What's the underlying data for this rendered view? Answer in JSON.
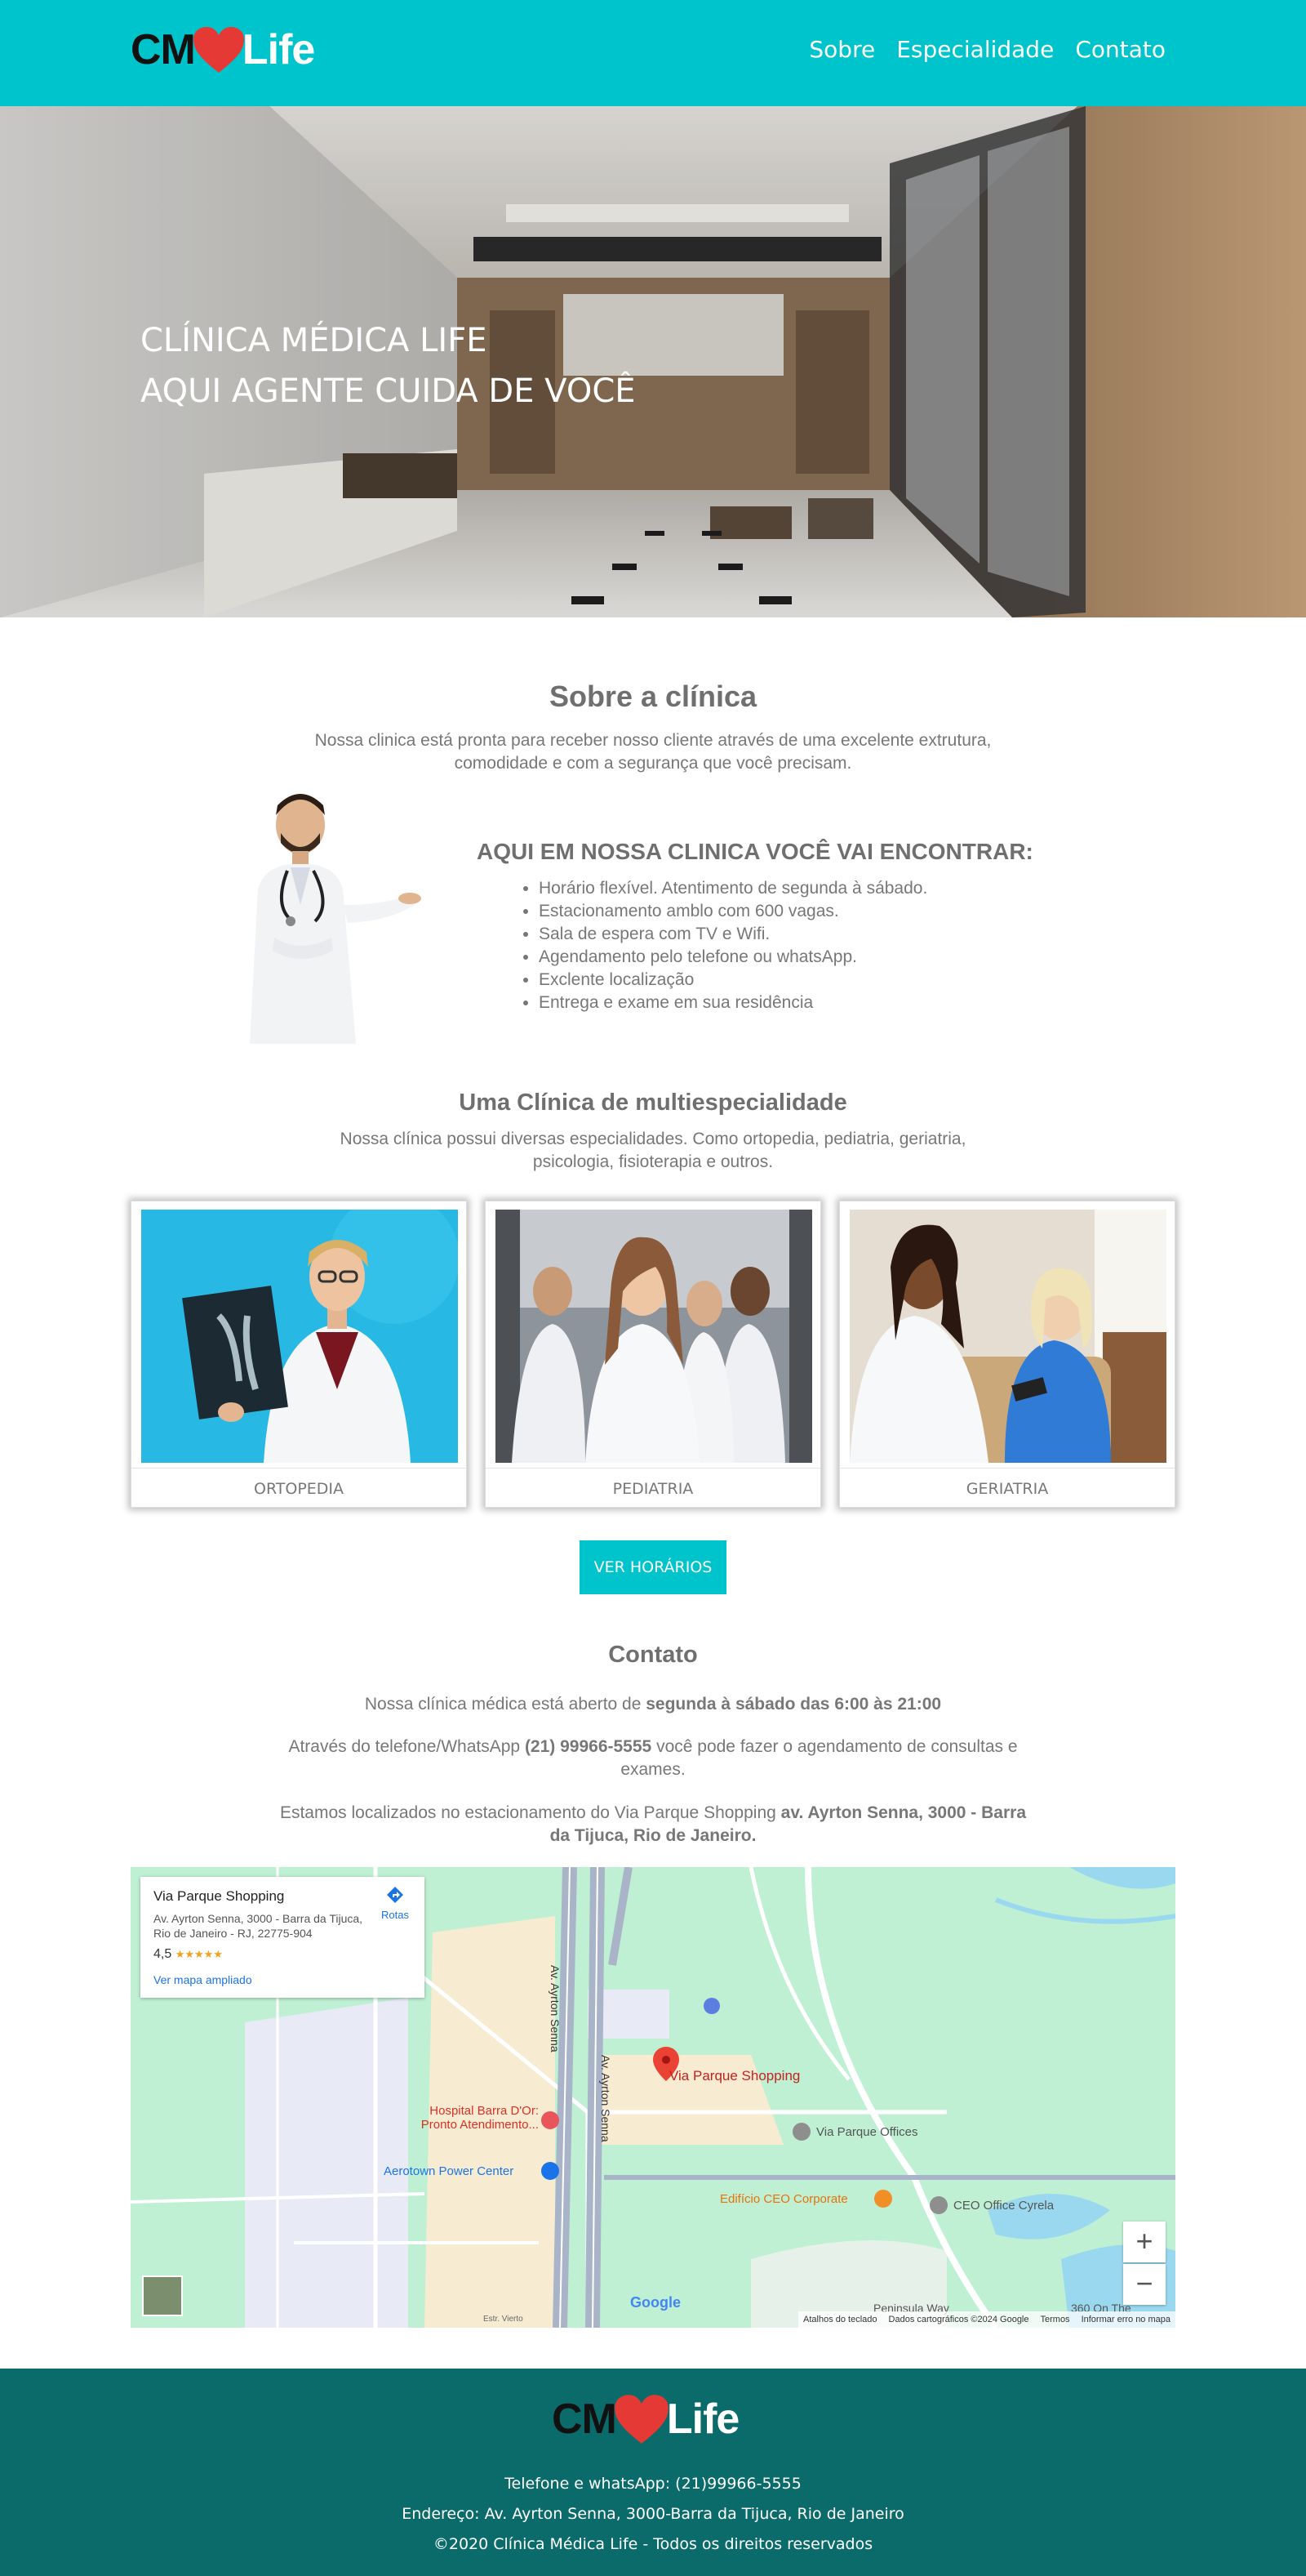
{
  "header": {
    "logo_cm": "CM",
    "logo_life": "Life",
    "nav": [
      "Sobre",
      "Especialidade",
      "Contato"
    ]
  },
  "hero": {
    "line1": "CLÍNICA MÉDICA LIFE",
    "line2": "AQUI AGENTE CUIDA DE VOCÊ"
  },
  "about": {
    "title": "Sobre a clínica",
    "text": "Nossa clinica está pronta para receber nosso cliente através de uma excelente extrutura, comodidade e com a segurança que você precisam.",
    "find_title": "AQUI EM NOSSA CLINICA VOCÊ VAI ENCONTRAR:",
    "items": [
      "Horário flexível. Atentimento de segunda à sábado.",
      "Estacionamento amblo com 600 vagas.",
      "Sala de espera com TV e Wifi.",
      "Agendamento pelo telefone ou whatsApp.",
      "Exclente localização",
      "Entrega e exame em sua residência"
    ]
  },
  "specialty": {
    "title": "Uma Clínica de multiespecialidade",
    "text": "Nossa clínica possui diversas especialidades. Como ortopedia, pediatria, geriatria, psicologia, fisioterapia e outros.",
    "cards": [
      "ORTOPEDIA",
      "PEDIATRIA",
      "GERIATRIA"
    ],
    "button": "VER HORÁRIOS"
  },
  "contact": {
    "title": "Contato",
    "p1_pre": "Nossa clínica médica está aberto de ",
    "p1_bold": "segunda à sábado das 6:00 às 21:00",
    "p2_pre": "Através do telefone/WhatsApp ",
    "p2_bold": "(21) 99966-5555",
    "p2_post": " você pode fazer o agendamento de consultas e exames.",
    "p3_pre": "Estamos localizados no estacionamento do Via Parque Shopping ",
    "p3_bold": "av. Ayrton Senna, 3000 - Barra da Tijuca, Rio de Janeiro."
  },
  "map": {
    "place_title": "Via Parque Shopping",
    "place_address": "Av. Ayrton Senna, 3000 - Barra da Tijuca, Rio de Janeiro - RJ, 22775-904",
    "rating": "4,5",
    "stars": "★★★★★",
    "enlarge": "Ver mapa ampliado",
    "directions": "Rotas",
    "labels": {
      "road1": "Av. Ayrton Senna",
      "road2": "Av. Ayrton Senna",
      "shopping": "Via Parque Shopping",
      "hospital": "Hospital Barra D'Or: Pronto Atendimento...",
      "aerotown": "Aerotown Power Center",
      "offices": "Via Parque Offices",
      "ceo": "Edifício CEO Corporate",
      "cyrela": "CEO Office Cyrela",
      "peninsula": "Peninsula Way",
      "vista": "360 On The",
      "street": "Estr. Vierto"
    },
    "zoom_in": "+",
    "zoom_out": "−",
    "google": "Google",
    "footer": [
      "Atalhos do teclado",
      "Dados cartográficos ©2024 Google",
      "Termos",
      "Informar erro no mapa"
    ],
    "colors": {
      "land": "#bff0d3",
      "road": "#ffffff",
      "road_major": "#aab4c8",
      "mall": "#f7ecd1",
      "water": "#9ad8ef"
    }
  },
  "footer": {
    "logo_cm": "CM",
    "logo_life": "Life",
    "phone": "Telefone e whatsApp: (21)99966-5555",
    "address": "Endereço: Av. Ayrton Senna, 3000-Barra da Tijuca, Rio de Janeiro",
    "copyright": "©2020 Clínica Médica Life - Todos os direitos reservados"
  },
  "colors": {
    "brand": "#00c4cc",
    "footer": "#0b6b6b",
    "heart": "#e53935"
  }
}
